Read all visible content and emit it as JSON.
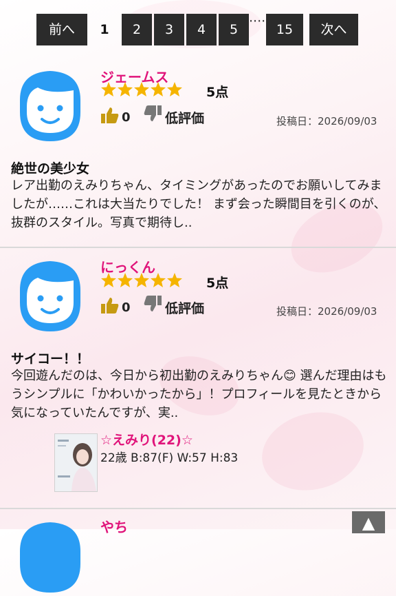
{
  "pagination": {
    "prev": "前へ",
    "pages": [
      "1",
      "2",
      "3",
      "4",
      "5"
    ],
    "ellipsis": "····",
    "last": "15",
    "next": "次へ"
  },
  "reviews": [
    {
      "name": "ジェームス",
      "rating": 5,
      "score": "5点",
      "likes": "0",
      "dislike_label": "低評価",
      "date": "投稿日：2026/09/03",
      "title": "絶世の美少女",
      "body": "レア出勤のえみりちゃん、タイミングがあったのでお願いしてみましたが……これは大当たりでした！ まず会った瞬間目を引くのが、抜群のスタイル。写真で期待し.."
    },
    {
      "name": "にっくん",
      "rating": 5,
      "score": "5点",
      "likes": "0",
      "dislike_label": "低評価",
      "date": "投稿日：2026/09/03",
      "title": "サイコー！！",
      "body": "今回遊んだのは、今日から初出勤のえみりちゃん😊 選んだ理由はもうシンプルに「かわいかったから」！プロフィールを見たときから気になっていたんですが、実..",
      "cast": {
        "name": "☆えみり(22)☆",
        "spec": "22歳 B:87(F) W:57 H:83"
      }
    },
    {
      "name": "やち"
    }
  ],
  "colors": {
    "accent_pink": "#e0147a",
    "star_gold": "#f5b400",
    "avatar_blue": "#2a9df4",
    "pager_bg": "#2b2b2b"
  },
  "icons": {
    "avatar": "boy-face-icon",
    "like": "thumbs-up-icon",
    "dislike": "thumbs-down-icon",
    "scroll_top": "arrow-up-icon"
  },
  "scroll_top_label": "▲"
}
